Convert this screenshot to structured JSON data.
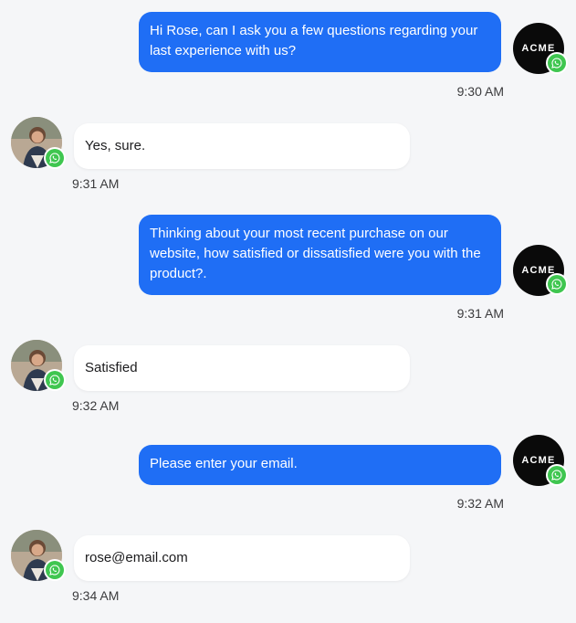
{
  "brand": {
    "logo_text": "ACME",
    "accent_color": "#1f6ef5",
    "whatsapp_color": "#3fc650"
  },
  "messages": [
    {
      "direction": "outgoing",
      "text": "Hi Rose, can I ask you a few questions regarding your last experience with us?",
      "time": "9:30 AM"
    },
    {
      "direction": "incoming",
      "text": "Yes, sure.",
      "time": "9:31 AM"
    },
    {
      "direction": "outgoing",
      "text": "Thinking about your most recent purchase on our website, how satisfied or dissatisfied were you with the product?.",
      "time": "9:31 AM"
    },
    {
      "direction": "incoming",
      "text": "Satisfied",
      "time": "9:32 AM"
    },
    {
      "direction": "outgoing",
      "text": "Please enter your email.",
      "time": "9:32 AM"
    },
    {
      "direction": "incoming",
      "text": "rose@email.com",
      "time": "9:34 AM"
    }
  ]
}
